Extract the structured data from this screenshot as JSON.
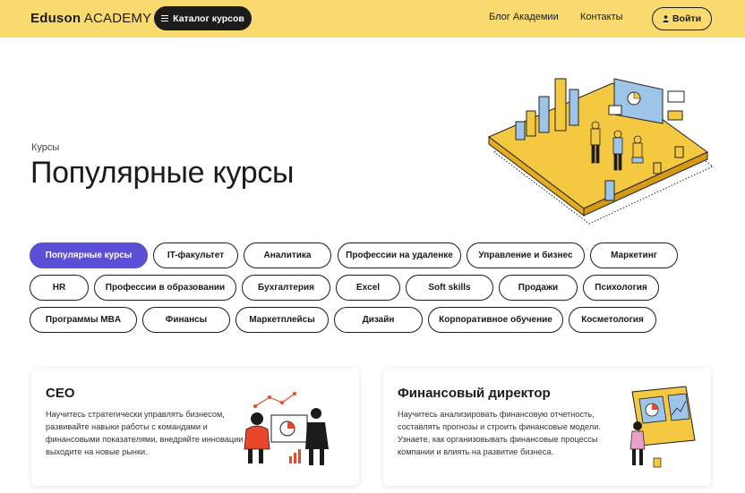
{
  "header": {
    "logo_bold": "Eduson",
    "logo_light": "ACADEMY",
    "catalog_label": "Каталог курсов",
    "nav": [
      "Блог Академии",
      "Контакты"
    ],
    "login_label": "Войти"
  },
  "breadcrumb": "Курсы",
  "page_title": "Популярные курсы",
  "categories": [
    "Популярные курсы",
    "IT-факультет",
    "Аналитика",
    "Профессии на удаленке",
    "Управление и бизнес",
    "Маркетинг",
    "HR",
    "Профессии в образовании",
    "Бухгалтерия",
    "Excel",
    "Soft skills",
    "Продажи",
    "Психология",
    "Программы MBA",
    "Финансы",
    "Маркетплейсы",
    "Дизайн",
    "Корпоративное обучение",
    "Косметология"
  ],
  "active_category": "Популярные курсы",
  "courses": [
    {
      "title": "CEO",
      "description": "Научитесь стратегически управлять бизнесом, развивайте навыки работы с командами и финансовыми показателями, внедряйте инновации и выходите на новые рынки."
    },
    {
      "title": "Финансовый директор",
      "description": "Научитесь анализировать финансовую отчетность, составлять прогнозы и строить финансовые модели. Узнаете, как организовывать финансовые процессы компании и влиять на развитие бизнеса."
    }
  ],
  "colors": {
    "header_bg": "#f8da6f",
    "accent": "#5b4fd6",
    "dark": "#1b1b1b",
    "illustration_yellow": "#f5c842",
    "illustration_red": "#e8472b"
  }
}
